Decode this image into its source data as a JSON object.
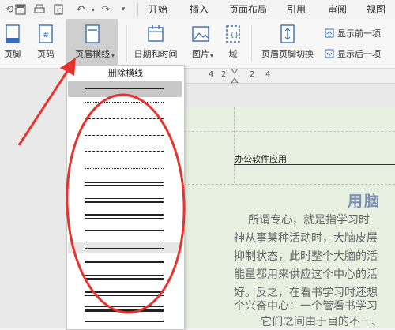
{
  "menu_tabs": [
    "开始",
    "插入",
    "页面布局",
    "引用",
    "审阅",
    "视图"
  ],
  "ribbon": {
    "footer_label": "页脚",
    "page_number_label": "页码",
    "header_line_label": "页眉横线",
    "datetime_label": "日期和时间",
    "picture_label": "图片",
    "field_label": "域",
    "switch_label": "页眉页脚切换",
    "show_prev_label": "显示前一项",
    "show_next_label": "显示后一项"
  },
  "ruler": {
    "numbers": [
      "4",
      "2",
      "2",
      "4"
    ]
  },
  "dropdown": {
    "delete_label": "删除横线"
  },
  "document": {
    "header_text": "办公软件应用",
    "title": "用脑",
    "lines": [
      "所谓专心，就是指学习时",
      "神从事某种活动时，大脑皮层",
      "抑制状态，此时整个大脑的活",
      "能量都用来供应这个中心的活",
      "好。反之，在看书学习时还想",
      "个兴奋中心：一个管看书学习",
      "它们之间由于目的不一、"
    ]
  },
  "colors": {
    "annotation": "#e8322b",
    "title": "#7c8fb4",
    "page": "#e8f0e2"
  }
}
